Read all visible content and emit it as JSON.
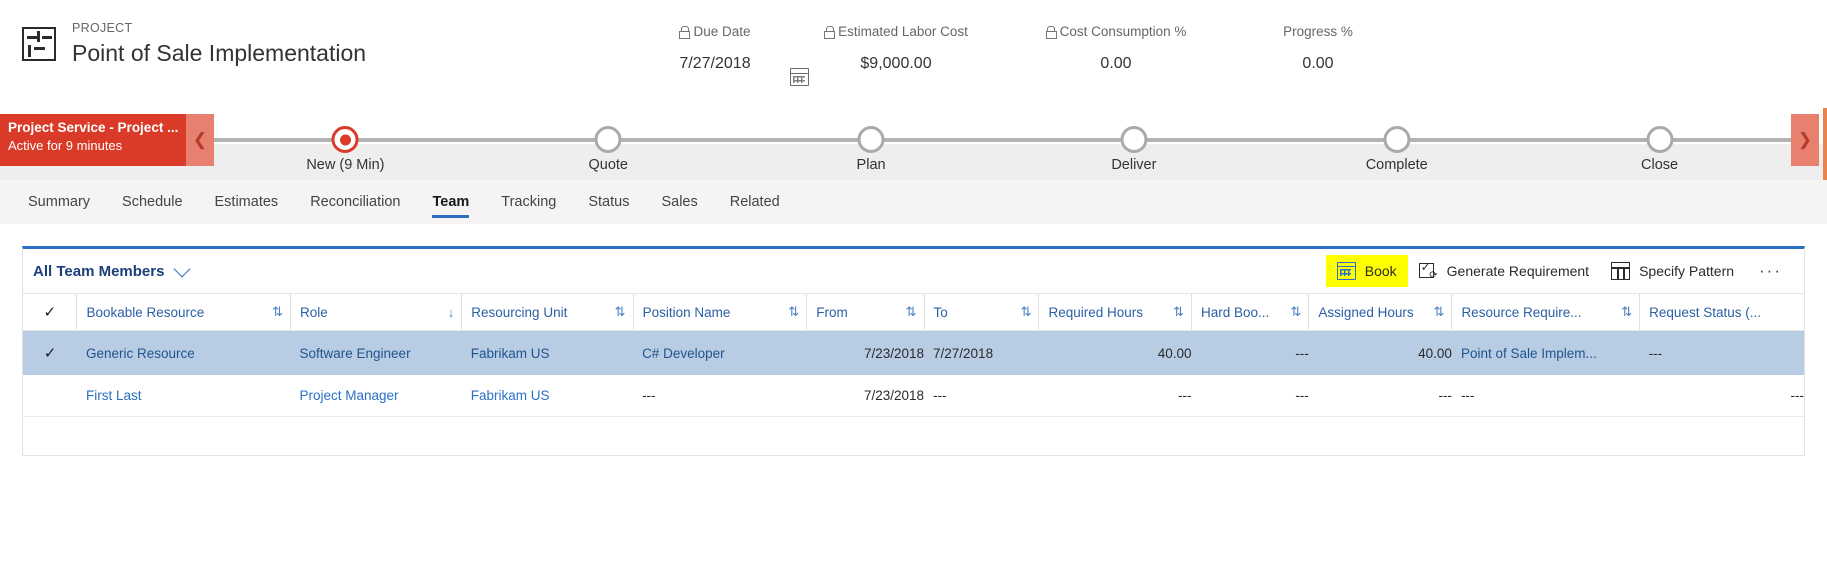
{
  "header": {
    "entity_icon": "project-entity-icon",
    "kicker": "PROJECT",
    "title": "Point of Sale Implementation",
    "metrics": [
      {
        "label": "Due Date",
        "value": "7/27/2018",
        "locked": true,
        "icon": "calendar-icon"
      },
      {
        "label": "Estimated Labor Cost",
        "value": "$9,000.00",
        "locked": true
      },
      {
        "label": "Cost Consumption %",
        "value": "0.00",
        "locked": true
      },
      {
        "label": "Progress %",
        "value": "0.00",
        "locked": false
      }
    ]
  },
  "business_process_flow": {
    "banner_title": "Project Service - Project ...",
    "banner_subtitle": "Active for 9 minutes",
    "prev_icon": "chevron-left-icon",
    "next_icon": "chevron-right-icon",
    "banner_color": "#d93b28",
    "active_color": "#d93b28",
    "stages": [
      {
        "name": "New  (9 Min)",
        "active": true
      },
      {
        "name": "Quote",
        "active": false
      },
      {
        "name": "Plan",
        "active": false
      },
      {
        "name": "Deliver",
        "active": false
      },
      {
        "name": "Complete",
        "active": false
      },
      {
        "name": "Close",
        "active": false
      }
    ]
  },
  "tabs": {
    "accent_color": "#2b70c4",
    "items": [
      {
        "label": "Summary",
        "active": false
      },
      {
        "label": "Schedule",
        "active": false
      },
      {
        "label": "Estimates",
        "active": false
      },
      {
        "label": "Reconciliation",
        "active": false
      },
      {
        "label": "Team",
        "active": true
      },
      {
        "label": "Tracking",
        "active": false
      },
      {
        "label": "Status",
        "active": false
      },
      {
        "label": "Sales",
        "active": false
      },
      {
        "label": "Related",
        "active": false
      }
    ]
  },
  "grid": {
    "view_name": "All Team Members",
    "toolbar": {
      "book_label": "Book",
      "book_icon": "calendar-icon",
      "book_highlight_color": "#ffff00",
      "generate_requirement_label": "Generate Requirement",
      "generate_requirement_icon": "checkbox-refresh-icon",
      "specify_pattern_label": "Specify Pattern",
      "specify_pattern_icon": "table-grid-icon",
      "overflow_label": "···"
    },
    "select_all_icon": "checkmark-icon",
    "columns": [
      {
        "label": "Bookable Resource",
        "sort": "unsorted"
      },
      {
        "label": "Role",
        "sort": "desc"
      },
      {
        "label": "Resourcing Unit",
        "sort": "unsorted"
      },
      {
        "label": "Position Name",
        "sort": "unsorted"
      },
      {
        "label": "From",
        "sort": "unsorted"
      },
      {
        "label": "To",
        "sort": "unsorted"
      },
      {
        "label": "Required Hours",
        "sort": "unsorted"
      },
      {
        "label": "Hard Boo...",
        "sort": "unsorted"
      },
      {
        "label": "Assigned Hours",
        "sort": "unsorted"
      },
      {
        "label": "Resource Require...",
        "sort": "unsorted"
      },
      {
        "label": "Request Status (...",
        "sort": "none"
      }
    ],
    "rows": [
      {
        "selected": true,
        "check": "✓",
        "bookable_resource": "Generic Resource",
        "role": "Software Engineer",
        "resourcing_unit": "Fabrikam US",
        "position_name": "C# Developer",
        "from": "7/23/2018",
        "to": "7/27/2018",
        "required_hours": "40.00",
        "hard_booked": "---",
        "assigned_hours": "40.00",
        "resource_requirement": "Point of Sale Implem...",
        "request_status": "---"
      },
      {
        "selected": false,
        "check": "",
        "bookable_resource": "First Last",
        "role": "Project Manager",
        "resourcing_unit": "Fabrikam US",
        "position_name": "---",
        "from": "7/23/2018",
        "to": "---",
        "required_hours": "---",
        "hard_booked": "---",
        "assigned_hours": "---",
        "resource_requirement": "---",
        "request_status": "---"
      }
    ]
  }
}
